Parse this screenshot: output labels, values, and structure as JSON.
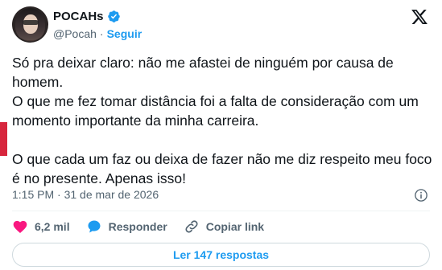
{
  "tweet": {
    "author_name": "POCAHs",
    "handle": "@Pocah",
    "separator": "·",
    "follow_label": "Seguir",
    "paragraphs": [
      "Só pra deixar claro: não me afastei de ninguém por causa de homem.",
      "O que me fez tomar distância foi a falta de consideração com um momento importante da minha carreira.",
      "O que cada um faz ou deixa de fazer não me diz respeito meu foco é no presente. Apenas isso!"
    ],
    "timestamp": "1:15 PM · 31 de mar de 2026"
  },
  "actions": {
    "like_count": "6,2 mil",
    "reply_label": "Responder",
    "copy_link_label": "Copiar link"
  },
  "read_replies_label": "Ler 147 respostas",
  "colors": {
    "accent": "#1d9bf0",
    "like": "#f91880",
    "text": "#0f1419",
    "muted": "#536471",
    "side_marker": "#d7263d"
  },
  "icons": {
    "verified": "verified-badge-icon",
    "logo": "x-logo-icon",
    "info": "info-icon",
    "like": "heart-icon",
    "reply": "speech-bubble-icon",
    "copy_link": "link-icon"
  }
}
